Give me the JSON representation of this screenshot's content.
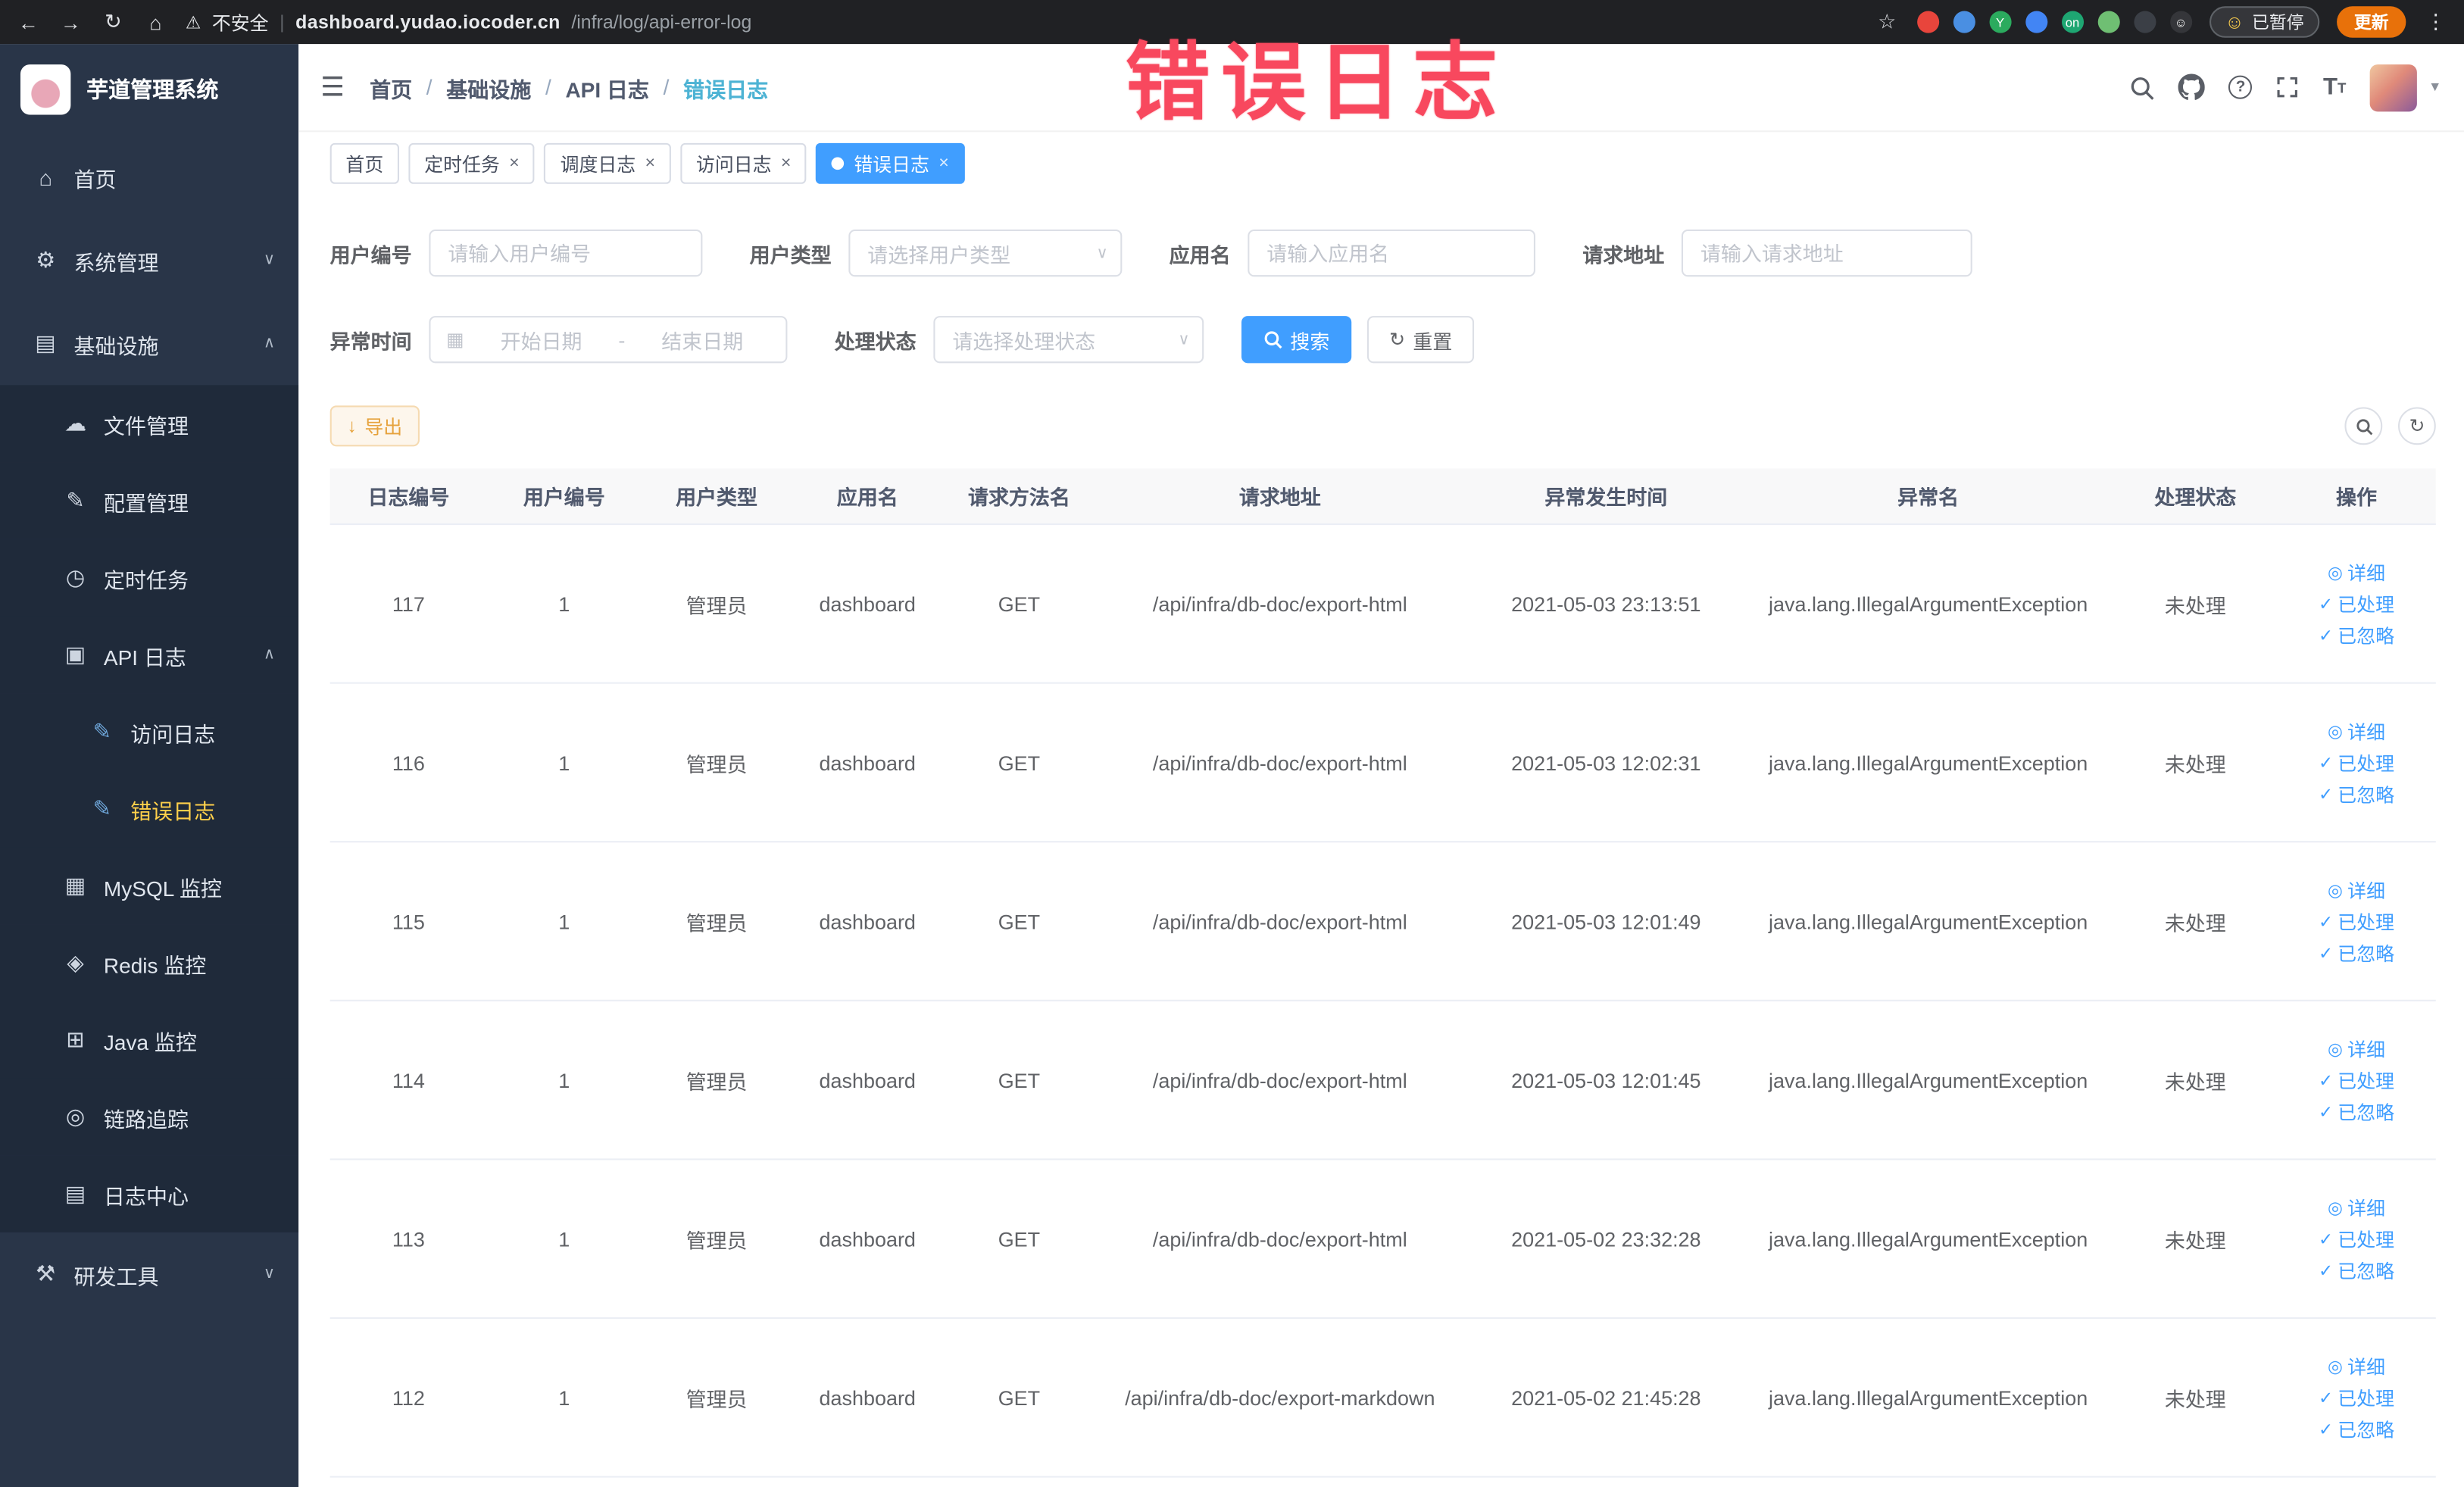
{
  "browser": {
    "security_label": "不安全",
    "url_domain": "dashboard.yudao.iocoder.cn",
    "url_path": "/infra/log/api-error-log",
    "paused_label": "已暂停",
    "update_label": "更新",
    "extensions": [
      {
        "name": "extension-red-icon",
        "color": "#e8453c",
        "text": ""
      },
      {
        "name": "extension-blue-drop-icon",
        "color": "#4a8fe2",
        "text": ""
      },
      {
        "name": "extension-green-icon",
        "color": "#2bab5e",
        "text": "Y"
      },
      {
        "name": "extension-grid-icon",
        "color": "#4285f4",
        "text": ""
      },
      {
        "name": "extension-on-badge-icon",
        "color": "#1ea672",
        "text": "on"
      },
      {
        "name": "extension-leaf-icon",
        "color": "#6fbf73",
        "text": ""
      },
      {
        "name": "extension-dark-tool-icon",
        "color": "#3b3f46",
        "text": ""
      },
      {
        "name": "extension-smiley-icon",
        "color": "#35363a",
        "text": "☺"
      }
    ]
  },
  "icons": {
    "back-icon": "←",
    "forward-icon": "→",
    "reload-icon": "↻",
    "browser-home-icon": "⌂",
    "warning-icon": "⚠",
    "divider": "|",
    "star-icon": "☆",
    "menu-dots-icon": "⋮",
    "hamburger-icon": "☰",
    "caret-down-icon": "▾",
    "smiley-icon": "☺",
    "calendar-icon": "▦",
    "reset-icon": "↻",
    "refresh-icon": "↻",
    "download-icon": "↓",
    "select-caret": "∨",
    "chevron-down": "∨",
    "chevron-up": "∧",
    "home-icon": "⌂",
    "gear-icon": "⚙",
    "grid-icon": "▤",
    "cloud-icon": "☁",
    "edit-icon": "✎",
    "clock-icon": "◷",
    "doc-icon": "▣",
    "doc-edit-icon": "✎",
    "database-icon": "▦",
    "redis-icon": "◈",
    "monitor-icon": "⊞",
    "eye-icon": "◎",
    "log-icon": "▤",
    "tools-icon": "⚒",
    "check-icon": "✓"
  },
  "sidebar": {
    "logo_title": "芋道管理系统",
    "items": [
      {
        "key": "home",
        "label": "首页",
        "icon": "home-icon",
        "level": 1
      },
      {
        "key": "system",
        "label": "系统管理",
        "icon": "gear-icon",
        "level": 1,
        "chevron": "down"
      },
      {
        "key": "infra",
        "label": "基础设施",
        "icon": "grid-icon",
        "level": 1,
        "chevron": "up"
      },
      {
        "key": "file",
        "label": "文件管理",
        "icon": "cloud-icon",
        "level": 2
      },
      {
        "key": "config",
        "label": "配置管理",
        "icon": "edit-icon",
        "level": 2
      },
      {
        "key": "job",
        "label": "定时任务",
        "icon": "clock-icon",
        "level": 2
      },
      {
        "key": "api-log",
        "label": "API 日志",
        "icon": "doc-icon",
        "level": 2,
        "chevron": "up"
      },
      {
        "key": "access-log",
        "label": "访问日志",
        "icon": "doc-edit-icon",
        "level": 3
      },
      {
        "key": "error-log",
        "label": "错误日志",
        "icon": "doc-edit-icon",
        "level": 3,
        "active": true
      },
      {
        "key": "mysql",
        "label": "MySQL 监控",
        "icon": "database-icon",
        "level": 2
      },
      {
        "key": "redis",
        "label": "Redis 监控",
        "icon": "redis-icon",
        "level": 2
      },
      {
        "key": "java",
        "label": "Java 监控",
        "icon": "monitor-icon",
        "level": 2
      },
      {
        "key": "trace",
        "label": "链路追踪",
        "icon": "eye-icon",
        "level": 2
      },
      {
        "key": "log-center",
        "label": "日志中心",
        "icon": "log-icon",
        "level": 2
      },
      {
        "key": "dev-tools",
        "label": "研发工具",
        "icon": "tools-icon",
        "level": 1,
        "chevron": "down"
      }
    ]
  },
  "topbar": {
    "breadcrumb": [
      "首页",
      "基础设施",
      "API 日志",
      "错误日志"
    ]
  },
  "tabs": [
    {
      "key": "home",
      "label": "首页",
      "closable": false,
      "active": false
    },
    {
      "key": "job",
      "label": "定时任务",
      "closable": true,
      "active": false
    },
    {
      "key": "job-log",
      "label": "调度日志",
      "closable": true,
      "active": false
    },
    {
      "key": "access-log",
      "label": "访问日志",
      "closable": true,
      "active": false
    },
    {
      "key": "error-log",
      "label": "错误日志",
      "closable": true,
      "active": true
    }
  ],
  "overlay": {
    "text": "错误日志"
  },
  "filters": {
    "user_id": {
      "label": "用户编号",
      "placeholder": "请输入用户编号"
    },
    "user_type": {
      "label": "用户类型",
      "placeholder": "请选择用户类型"
    },
    "app_name": {
      "label": "应用名",
      "placeholder": "请输入应用名"
    },
    "request_url": {
      "label": "请求地址",
      "placeholder": "请输入请求地址"
    },
    "exception_time": {
      "label": "异常时间",
      "start_placeholder": "开始日期",
      "separator": "-",
      "end_placeholder": "结束日期"
    },
    "process_status": {
      "label": "处理状态",
      "placeholder": "请选择处理状态"
    },
    "search_label": "搜索",
    "reset_label": "重置"
  },
  "toolbar": {
    "export_label": "导出"
  },
  "table": {
    "columns": [
      "日志编号",
      "用户编号",
      "用户类型",
      "应用名",
      "请求方法名",
      "请求地址",
      "异常发生时间",
      "异常名",
      "处理状态",
      "操作"
    ],
    "col_keys": [
      "log-id",
      "user-id",
      "user-type",
      "app-name",
      "method",
      "request-url",
      "exception-time",
      "exception-name",
      "status",
      "actions"
    ],
    "rows": [
      {
        "log_id": "117",
        "user_id": "1",
        "user_type": "管理员",
        "app_name": "dashboard",
        "method": "GET",
        "request_url": "/api/infra/db-doc/export-html",
        "exception_time": "2021-05-03 23:13:51",
        "exception_name": "java.lang.IllegalArgumentException",
        "status": "未处理"
      },
      {
        "log_id": "116",
        "user_id": "1",
        "user_type": "管理员",
        "app_name": "dashboard",
        "method": "GET",
        "request_url": "/api/infra/db-doc/export-html",
        "exception_time": "2021-05-03 12:02:31",
        "exception_name": "java.lang.IllegalArgumentException",
        "status": "未处理"
      },
      {
        "log_id": "115",
        "user_id": "1",
        "user_type": "管理员",
        "app_name": "dashboard",
        "method": "GET",
        "request_url": "/api/infra/db-doc/export-html",
        "exception_time": "2021-05-03 12:01:49",
        "exception_name": "java.lang.IllegalArgumentException",
        "status": "未处理"
      },
      {
        "log_id": "114",
        "user_id": "1",
        "user_type": "管理员",
        "app_name": "dashboard",
        "method": "GET",
        "request_url": "/api/infra/db-doc/export-html",
        "exception_time": "2021-05-03 12:01:45",
        "exception_name": "java.lang.IllegalArgumentException",
        "status": "未处理"
      },
      {
        "log_id": "113",
        "user_id": "1",
        "user_type": "管理员",
        "app_name": "dashboard",
        "method": "GET",
        "request_url": "/api/infra/db-doc/export-html",
        "exception_time": "2021-05-02 23:32:28",
        "exception_name": "java.lang.IllegalArgumentException",
        "status": "未处理"
      },
      {
        "log_id": "112",
        "user_id": "1",
        "user_type": "管理员",
        "app_name": "dashboard",
        "method": "GET",
        "request_url": "/api/infra/db-doc/export-markdown",
        "exception_time": "2021-05-02 21:45:28",
        "exception_name": "java.lang.IllegalArgumentException",
        "status": "未处理"
      }
    ],
    "row_actions": [
      {
        "key": "detail",
        "label": "详细",
        "icon": "eye-icon"
      },
      {
        "key": "processed",
        "label": "已处理",
        "icon": "check-icon"
      },
      {
        "key": "ignored",
        "label": "已忽略",
        "icon": "check-icon"
      }
    ]
  }
}
